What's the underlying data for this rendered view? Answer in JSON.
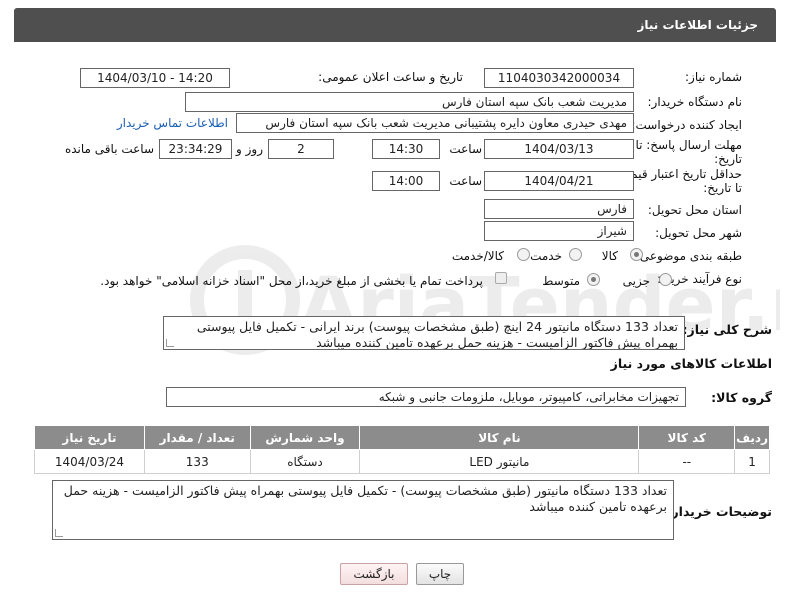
{
  "header": {
    "title": "جزئیات اطلاعات نیاز"
  },
  "fields": {
    "need_number_label": "شماره نیاز:",
    "need_number": "1104030342000034",
    "announce_label": "تاریخ و ساعت اعلان عمومی:",
    "announce_value": "1404/03/10 - 14:20",
    "buyer_label": "نام دستگاه خریدار:",
    "buyer_value": "مدیریت شعب بانک سپه استان فارس",
    "creator_label": "ایجاد کننده درخواست:",
    "creator_value": "مهدی حیدری معاون دایره پشتیبانی مدیریت شعب بانک سپه استان فارس",
    "contact_link": "اطلاعات تماس خریدار",
    "deadline_label_1": "مهلت ارسال پاسخ: تا",
    "deadline_label_2": "تاریخ:",
    "deadline_date": "1404/03/13",
    "time_label": "ساعت",
    "deadline_time": "14:30",
    "days_value": "2",
    "days_label": "روز و",
    "remaining_value": "23:34:29",
    "remaining_label": "ساعت باقی مانده",
    "validity_label_1": "حداقل تاریخ اعتبار قیمت:",
    "validity_label_2": "تا تاریخ:",
    "validity_date": "1404/04/21",
    "validity_time": "14:00",
    "province_label": "استان محل تحویل:",
    "province_value": "فارس",
    "city_label": "شهر محل تحویل:",
    "city_value": "شیراز",
    "category_label": "طبقه بندی موضوعی:",
    "category_options": [
      "کالا",
      "خدمت",
      "کالا/خدمت"
    ],
    "category_selected": "کالا",
    "process_label": "نوع فرآیند خرید :",
    "process_options": [
      "جزیی",
      "متوسط"
    ],
    "process_selected": "متوسط",
    "payment_note": "پرداخت تمام یا بخشی از مبلغ خرید،از محل \"اسناد خزانه اسلامی\" خواهد بود."
  },
  "description": {
    "label": "شرح کلی نیاز:",
    "text": "تعداد 133 دستگاه مانیتور 24 اینچ (طبق مشخصات پیوست)  برند ایرانی - تکمیل فایل پیوستی بهمراه پیش فاکتور الزامیست - هزینه حمل برعهده تامین کننده میباشد"
  },
  "goods_section": {
    "title": "اطلاعات کالاهای مورد نیاز",
    "group_label": "گروه کالا:",
    "group_value": "تجهیزات مخابراتی، کامپیوتر، موبایل، ملزومات جانبی و شبکه"
  },
  "table": {
    "headers": [
      "ردیف",
      "کد کالا",
      "نام کالا",
      "واحد شمارش",
      "تعداد / مقدار",
      "تاریخ نیاز"
    ],
    "rows": [
      [
        "1",
        "--",
        "مانیتور LED",
        "دستگاه",
        "133",
        "1404/03/24"
      ]
    ]
  },
  "buyer_notes": {
    "label": "توضیحات خریدار:",
    "text": "تعداد 133 دستگاه مانیتور (طبق مشخصات پیوست) - تکمیل فایل پیوستی بهمراه پیش فاکتور الزامیست - هزینه حمل برعهده تامین کننده میباشد"
  },
  "buttons": {
    "print": "چاپ",
    "back": "بازگشت"
  },
  "watermark": {
    "text": "AriaTender.neT"
  },
  "colors": {
    "header_bg": "#4f4f4f",
    "table_header_bg": "#8c8c8c",
    "link": "#1a5fb4"
  }
}
